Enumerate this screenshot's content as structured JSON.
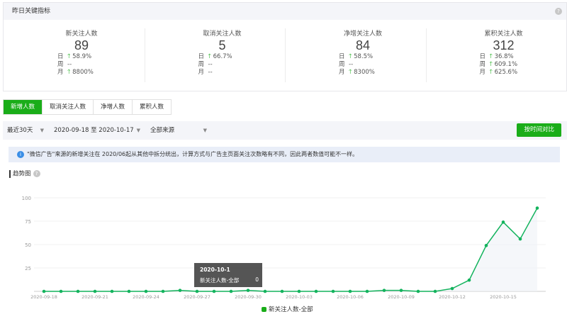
{
  "panel": {
    "title": "昨日关键指标",
    "help_icon": "question-icon",
    "stats": [
      {
        "title": "新关注人数",
        "value": "89",
        "rows": [
          {
            "k": "日",
            "v": "58.9%",
            "trend": "up"
          },
          {
            "k": "周",
            "v": "--",
            "trend": ""
          },
          {
            "k": "月",
            "v": "8800%",
            "trend": "up"
          }
        ]
      },
      {
        "title": "取消关注人数",
        "value": "5",
        "rows": [
          {
            "k": "日",
            "v": "66.7%",
            "trend": "up"
          },
          {
            "k": "周",
            "v": "--",
            "trend": ""
          },
          {
            "k": "月",
            "v": "--",
            "trend": ""
          }
        ]
      },
      {
        "title": "净增关注人数",
        "value": "84",
        "rows": [
          {
            "k": "日",
            "v": "58.5%",
            "trend": "up"
          },
          {
            "k": "周",
            "v": "--",
            "trend": ""
          },
          {
            "k": "月",
            "v": "8300%",
            "trend": "up"
          }
        ]
      },
      {
        "title": "累积关注人数",
        "value": "312",
        "rows": [
          {
            "k": "日",
            "v": "36.8%",
            "trend": "up"
          },
          {
            "k": "周",
            "v": "609.1%",
            "trend": "up"
          },
          {
            "k": "月",
            "v": "625.6%",
            "trend": "up"
          }
        ]
      }
    ]
  },
  "tabs": [
    {
      "label": "新增人数",
      "active": true
    },
    {
      "label": "取消关注人数"
    },
    {
      "label": "净增人数"
    },
    {
      "label": "累积人数"
    }
  ],
  "filters": {
    "period": "最近30天",
    "date_range": "2020-09-18 至 2020-10-17",
    "source": "全部来源",
    "compare_button": "按时间对比"
  },
  "notice": "\"微信广告\"来源的新增关注在 2020/06起从其他中拆分统出，计算方式与广告主页面关注次数略有不同，因此两者数值可能不一样。",
  "trend_title": "趋势图",
  "tooltip": {
    "date": "2020-10-1",
    "label": "新关注人数-全部",
    "value": "0"
  },
  "colors": {
    "accent": "#1aad19",
    "line": "#13b35d"
  },
  "chart_data": {
    "type": "line",
    "x": [
      "2020-09-18",
      "2020-09-19",
      "2020-09-20",
      "2020-09-21",
      "2020-09-22",
      "2020-09-23",
      "2020-09-24",
      "2020-09-25",
      "2020-09-26",
      "2020-09-27",
      "2020-09-28",
      "2020-09-29",
      "2020-09-30",
      "2020-10-01",
      "2020-10-02",
      "2020-10-03",
      "2020-10-04",
      "2020-10-05",
      "2020-10-06",
      "2020-10-07",
      "2020-10-08",
      "2020-10-09",
      "2020-10-10",
      "2020-10-11",
      "2020-10-12",
      "2020-10-13",
      "2020-10-14",
      "2020-10-15",
      "2020-10-16",
      "2020-10-17"
    ],
    "series": [
      {
        "name": "新关注人数-全部",
        "values": [
          0,
          0,
          0,
          0,
          0,
          0,
          0,
          0,
          1,
          0,
          0,
          0,
          1,
          0,
          0,
          0,
          0,
          0,
          0,
          0,
          1,
          1,
          0,
          0,
          3,
          12,
          49,
          74,
          56,
          89
        ]
      }
    ],
    "x_ticks": [
      "2020-09-18",
      "2020-09-21",
      "2020-09-24",
      "2020-09-27",
      "2020-09-30",
      "2020-10-03",
      "2020-10-06",
      "2020-10-09",
      "2020-10-12",
      "2020-10-15"
    ],
    "y_ticks": [
      "25",
      "50",
      "75",
      "100"
    ],
    "ylim": [
      0,
      100
    ],
    "grid": true,
    "legend": "bottom"
  }
}
